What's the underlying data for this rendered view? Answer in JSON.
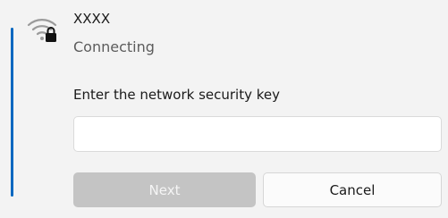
{
  "network": {
    "name": "XXXX",
    "status": "Connecting",
    "icon": "wifi-secured-icon"
  },
  "security_key": {
    "label": "Enter the network security key",
    "value": "",
    "placeholder": ""
  },
  "buttons": {
    "next": "Next",
    "cancel": "Cancel"
  },
  "colors": {
    "accent": "#0067c0",
    "disabled_button": "#c4c4c4",
    "background": "#f3f3f3"
  }
}
